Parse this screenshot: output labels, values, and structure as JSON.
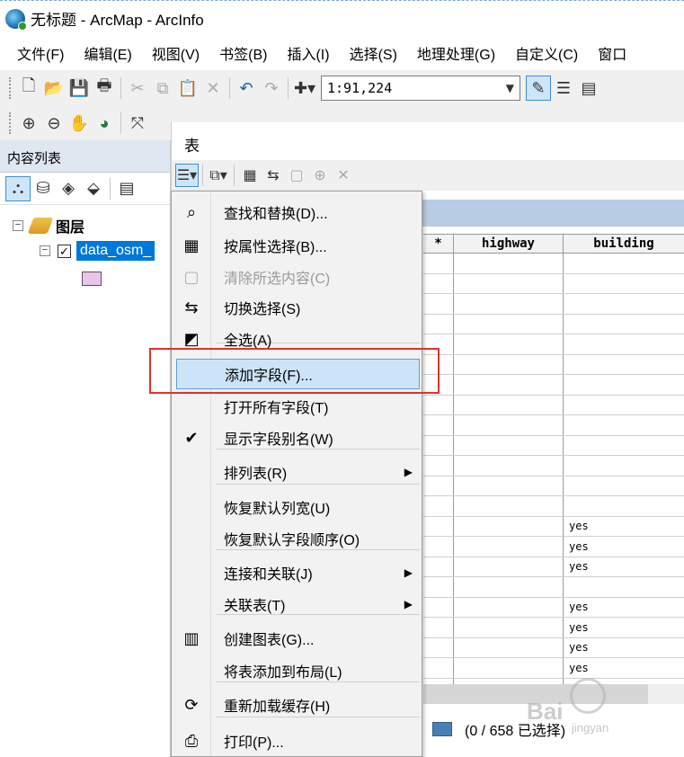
{
  "window": {
    "title": "无标题 - ArcMap - ArcInfo"
  },
  "menubar": [
    "文件(F)",
    "编辑(E)",
    "视图(V)",
    "书签(B)",
    "插入(I)",
    "选择(S)",
    "地理处理(G)",
    "自定义(C)",
    "窗口"
  ],
  "toolbar": {
    "scale": "1:91,224"
  },
  "toc": {
    "header": "内容列表",
    "layers_group": "图层",
    "layer_name": "data_osm_",
    "layer_checked": "✓"
  },
  "table_window": {
    "title": "表",
    "columns": [
      "*",
      "highway",
      "building"
    ],
    "rows": [
      [
        "",
        "",
        ""
      ],
      [
        "",
        "",
        ""
      ],
      [
        "",
        "",
        ""
      ],
      [
        "",
        "",
        ""
      ],
      [
        "",
        "",
        ""
      ],
      [
        "",
        "",
        ""
      ],
      [
        "",
        "",
        ""
      ],
      [
        "",
        "",
        ""
      ],
      [
        "",
        "",
        ""
      ],
      [
        "",
        "",
        ""
      ],
      [
        "",
        "",
        ""
      ],
      [
        "",
        "",
        ""
      ],
      [
        "",
        "",
        ""
      ],
      [
        "",
        "",
        "yes"
      ],
      [
        "",
        "",
        "yes"
      ],
      [
        "",
        "",
        "yes"
      ],
      [
        "",
        "",
        ""
      ],
      [
        "",
        "",
        "yes"
      ],
      [
        "",
        "",
        "yes"
      ],
      [
        "",
        "",
        "yes"
      ],
      [
        "",
        "",
        "yes"
      ],
      [
        "",
        "",
        ""
      ]
    ],
    "status": "(0 / 658 已选择)"
  },
  "context_menu": {
    "items": [
      {
        "label": "查找和替换(D)...",
        "icon": "binoculars-icon",
        "glyph": "⌕"
      },
      {
        "label": "按属性选择(B)...",
        "icon": "select-by-attributes-icon",
        "glyph": "▦"
      },
      {
        "label": "清除所选内容(C)",
        "icon": "clear-selection-icon",
        "glyph": "▢",
        "disabled": true
      },
      {
        "label": "切换选择(S)",
        "icon": "switch-selection-icon",
        "glyph": "⇆"
      },
      {
        "label": "全选(A)",
        "icon": "select-all-icon",
        "glyph": "◩"
      },
      {
        "label": "添加字段(F)...",
        "icon": "",
        "glyph": "",
        "highlighted": true
      },
      {
        "label": "打开所有字段(T)",
        "icon": "",
        "glyph": ""
      },
      {
        "label": "显示字段别名(W)",
        "icon": "checkmark-icon",
        "glyph": "✔"
      },
      {
        "label": "排列表(R)",
        "icon": "",
        "glyph": "",
        "submenu": true
      },
      {
        "label": "恢复默认列宽(U)",
        "icon": "",
        "glyph": ""
      },
      {
        "label": "恢复默认字段顺序(O)",
        "icon": "",
        "glyph": ""
      },
      {
        "label": "连接和关联(J)",
        "icon": "",
        "glyph": "",
        "submenu": true
      },
      {
        "label": "关联表(T)",
        "icon": "",
        "glyph": "",
        "submenu": true
      },
      {
        "label": "创建图表(G)...",
        "icon": "bar-chart-icon",
        "glyph": "▥"
      },
      {
        "label": "将表添加到布局(L)",
        "icon": "",
        "glyph": ""
      },
      {
        "label": "重新加载缓存(H)",
        "icon": "reload-icon",
        "glyph": "⟳"
      },
      {
        "label": "打印(P)...",
        "icon": "print-icon",
        "glyph": "⎙"
      }
    ],
    "submenu_arrow": "▶"
  },
  "watermark": {
    "text": "Bai",
    "sub": "jingyan"
  },
  "colors": {
    "highlight": "#cce4f7",
    "callout": "#e0322c",
    "selection": "#0078d7"
  }
}
